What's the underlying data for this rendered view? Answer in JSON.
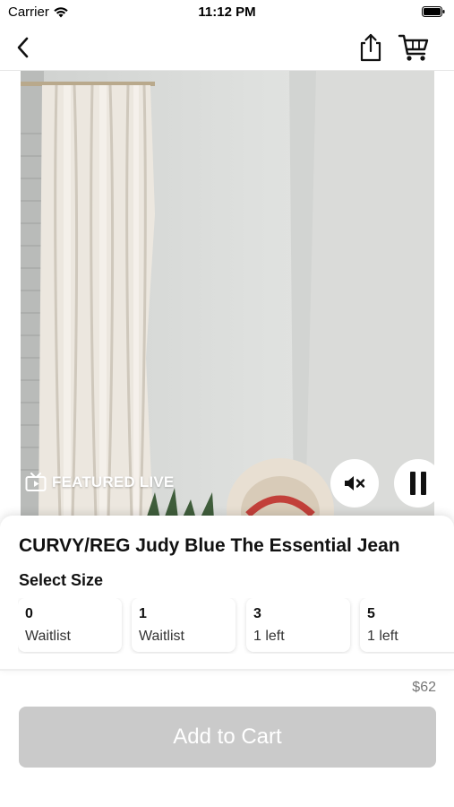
{
  "status_bar": {
    "carrier": "Carrier",
    "time": "11:12 PM"
  },
  "nav": {
    "back_icon": "chevron-left-icon",
    "share_icon": "share-icon",
    "cart_icon": "cart-icon"
  },
  "video": {
    "badge_label": "FEATURED LIVE",
    "badge_icon": "tv-play-icon",
    "mute_icon": "mute-icon",
    "pause_icon": "pause-icon"
  },
  "product": {
    "title": "CURVY/REG Judy Blue The Essential Jean",
    "select_size_label": "Select Size",
    "sizes": [
      {
        "size": "0",
        "status": "Waitlist"
      },
      {
        "size": "1",
        "status": "Waitlist"
      },
      {
        "size": "3",
        "status": "1 left"
      },
      {
        "size": "5",
        "status": "1 left"
      }
    ],
    "price": "$62",
    "add_to_cart_label": "Add to Cart"
  },
  "colors": {
    "button_disabled": "#cacaca",
    "accent": "#000000"
  }
}
